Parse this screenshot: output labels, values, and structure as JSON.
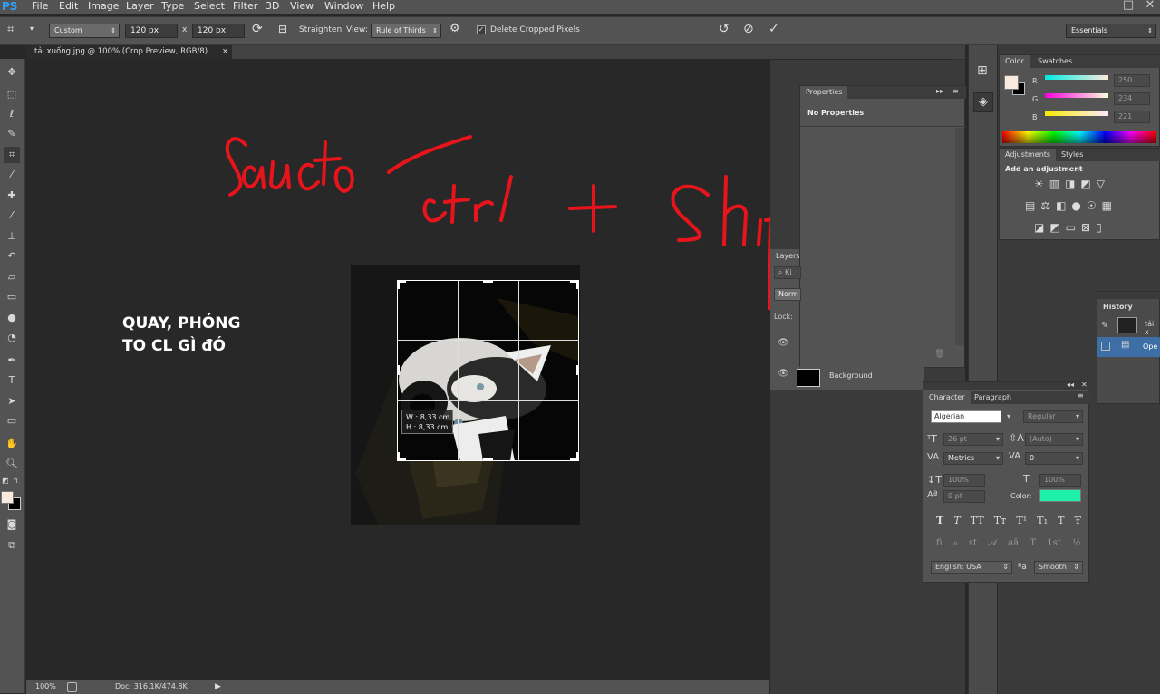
{
  "app": {
    "logo": "PS"
  },
  "menubar": {
    "items": [
      "File",
      "Edit",
      "Image",
      "Layer",
      "Type",
      "Select",
      "Filter",
      "3D",
      "View",
      "Window",
      "Help"
    ]
  },
  "window_controls": {
    "minimize": "—",
    "maximize": "□",
    "close": "✕"
  },
  "options_bar": {
    "preset": "Custom",
    "width": "120 px",
    "times": "x",
    "height": "120 px",
    "straighten_label": "Straighten",
    "view_label": "View:",
    "view_value": "Rule of Thirds",
    "delete_cropped_label": "Delete Cropped Pixels",
    "delete_cropped_checked": true,
    "workspace": "Essentials"
  },
  "document_tab": {
    "title": "tải xuống.jpg @ 100% (Crop Preview, RGB/8)",
    "close": "×"
  },
  "canvas_annotation": {
    "line1": "QUAY, PHÓNG",
    "line2": "TO CL GÌ đÓ"
  },
  "crop_readout": {
    "w": "W :  8,33 cm",
    "h": "H :  8,33 cm"
  },
  "status": {
    "zoom": "100%",
    "doc": "Doc: 316,1K/474,8K"
  },
  "color_panel": {
    "tabs": [
      "Color",
      "Swatches"
    ],
    "r_label": "R",
    "g_label": "G",
    "b_label": "B",
    "r": "250",
    "g": "234",
    "b": "221",
    "foreground": "#FAEADD",
    "background": "#000000"
  },
  "adjustments_panel": {
    "tabs": [
      "Adjustments",
      "Styles"
    ],
    "title": "Add an adjustment"
  },
  "properties_panel": {
    "tab": "Properties",
    "content": "No Properties"
  },
  "layers_panel": {
    "tab": "Layers",
    "search": "Ki",
    "blend": "Norm",
    "lock": "Lock:",
    "layer_name": "Background"
  },
  "history_panel": {
    "tab": "History",
    "item1": "tải x",
    "item2": "Ope"
  },
  "character_panel": {
    "tabs": [
      "Character",
      "Paragraph"
    ],
    "font_family": "Algerian",
    "font_style": "Regular",
    "size": "26 pt",
    "leading": "(Auto)",
    "kerning": "Metrics",
    "tracking": "0",
    "vscale": "100%",
    "hscale": "100%",
    "baseline": "0 pt",
    "color_label": "Color:",
    "color": "#1FF0A8",
    "styles": [
      "T",
      "T",
      "TT",
      "Tт",
      "T¹",
      "T₁",
      "T",
      "Ŧ"
    ],
    "opentype": [
      "ﬁ",
      "ℴ",
      "st",
      "𝒜",
      "aā",
      "T",
      "1st",
      "½"
    ],
    "language": "English: USA",
    "aa_icon": "ªa",
    "antialias": "Smooth"
  },
  "colors": {
    "accent_blue": "#2EA3FF",
    "annotation_red": "#E8141B",
    "ui_bg": "#535353"
  }
}
